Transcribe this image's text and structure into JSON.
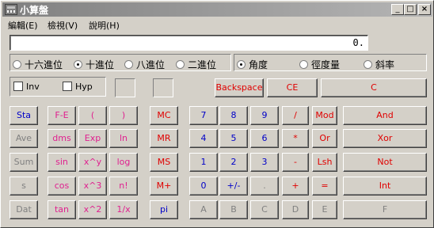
{
  "window": {
    "title": "小算盤",
    "minimize": "_",
    "maximize": "□",
    "close": "×"
  },
  "menu": [
    {
      "label": "編輯(E)"
    },
    {
      "label": "檢視(V)"
    },
    {
      "label": "說明(H)"
    }
  ],
  "display": {
    "value": "0."
  },
  "base_radios": [
    {
      "label": "十六進位",
      "selected": false
    },
    {
      "label": "十進位",
      "selected": true
    },
    {
      "label": "八進位",
      "selected": false
    },
    {
      "label": "二進位",
      "selected": false
    }
  ],
  "angle_radios": [
    {
      "label": "角度",
      "selected": true
    },
    {
      "label": "徑度量",
      "selected": false
    },
    {
      "label": "斜率",
      "selected": false
    }
  ],
  "checkboxes": [
    {
      "label": "Inv",
      "checked": false
    },
    {
      "label": "Hyp",
      "checked": false
    }
  ],
  "edit_buttons": {
    "backspace": "Backspace",
    "ce": "CE",
    "c": "C"
  },
  "left_buttons": [
    [
      "Sta",
      "F-E",
      "(",
      ")"
    ],
    [
      "Ave",
      "dms",
      "Exp",
      "ln"
    ],
    [
      "Sum",
      "sin",
      "x^y",
      "log"
    ],
    [
      "s",
      "cos",
      "x^3",
      "n!"
    ],
    [
      "Dat",
      "tan",
      "x^2",
      "1/x"
    ]
  ],
  "memory_buttons": [
    "MC",
    "MR",
    "MS",
    "M+",
    "pi"
  ],
  "number_buttons": [
    [
      "7",
      "8",
      "9",
      "/",
      "Mod",
      "And"
    ],
    [
      "4",
      "5",
      "6",
      "*",
      "Or",
      "Xor"
    ],
    [
      "1",
      "2",
      "3",
      "-",
      "Lsh",
      "Not"
    ],
    [
      "0",
      "+/-",
      ".",
      "+",
      "=",
      "Int"
    ],
    [
      "A",
      "B",
      "C",
      "D",
      "E",
      "F"
    ]
  ],
  "colors": {
    "blue": "#0000c8",
    "red": "#e00000",
    "magenta": "#e0208f",
    "disabled": "#808080",
    "face": "#d4d0c8"
  }
}
